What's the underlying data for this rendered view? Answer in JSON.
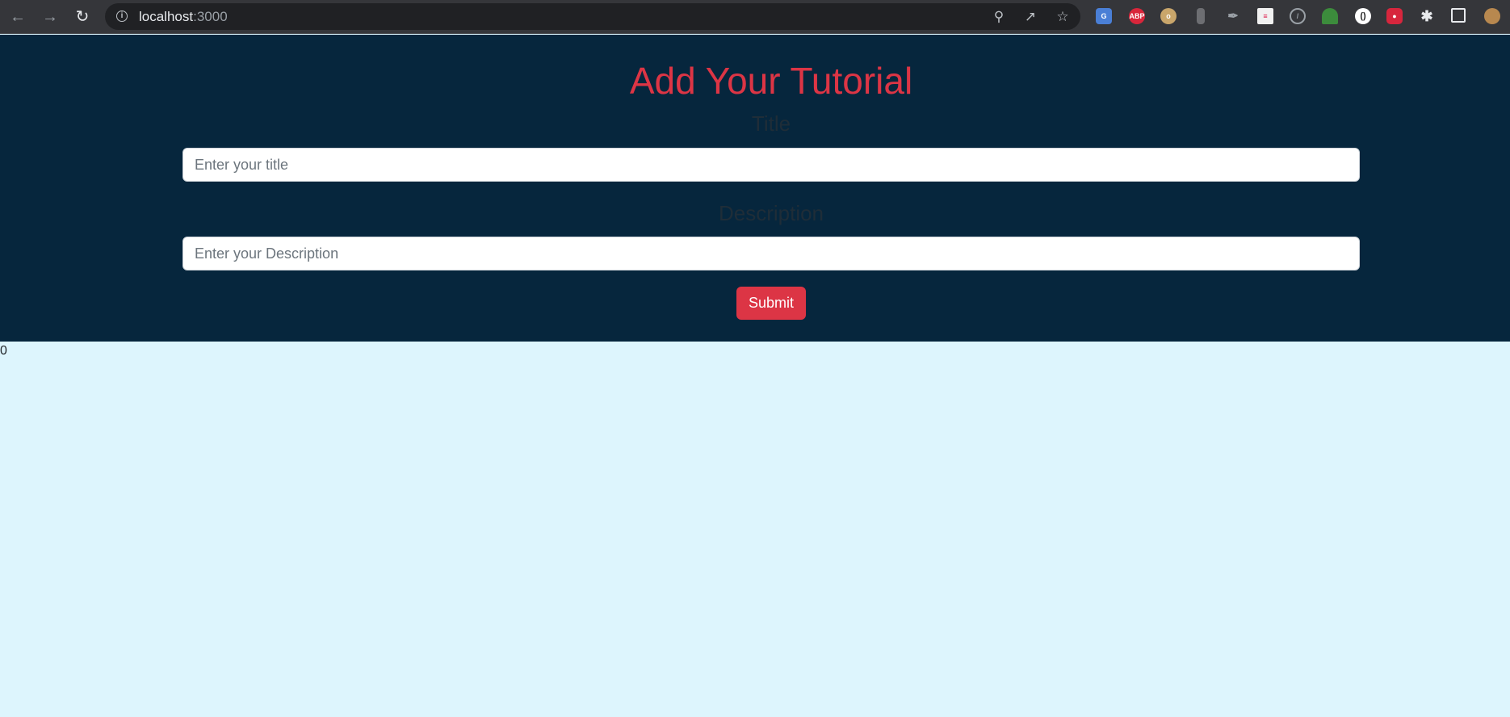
{
  "browser": {
    "url_host": "localhost",
    "url_port": ":3000",
    "extensions": [
      "google-translate-icon",
      "adblock-plus-icon",
      "owl-icon",
      "bottle-icon",
      "eyedropper-icon",
      "notes-icon",
      "compass-icon",
      "tree-icon",
      "circle-icon",
      "paw-icon",
      "puzzle-icon",
      "side-panel-icon",
      "profile-avatar-icon"
    ],
    "abp_label": "ABP"
  },
  "form": {
    "title": "Add Your Tutorial",
    "title_label": "Title",
    "title_placeholder": "Enter your title",
    "description_label": "Description",
    "description_placeholder": "Enter your Description",
    "submit_label": "Submit"
  },
  "footer": {
    "counter": "0"
  },
  "colors": {
    "header_bg": "#06263d",
    "accent": "#dc3545",
    "page_bg": "#ddf5fd"
  }
}
